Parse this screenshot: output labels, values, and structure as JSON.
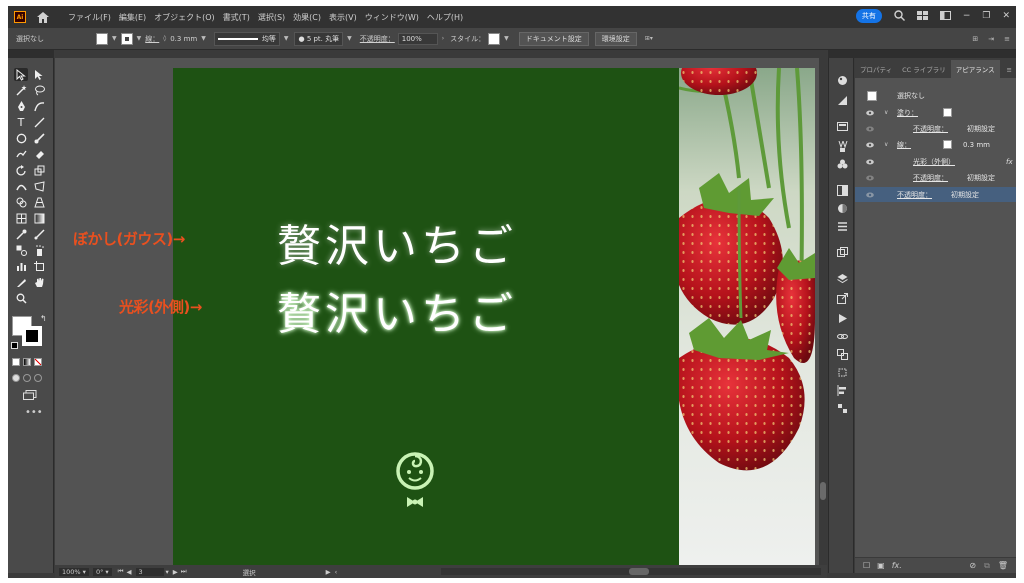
{
  "app": {
    "logo_text": "Ai"
  },
  "menu": {
    "items": [
      "ファイル(F)",
      "編集(E)",
      "オブジェクト(O)",
      "書式(T)",
      "選択(S)",
      "効果(C)",
      "表示(V)",
      "ウィンドウ(W)",
      "ヘルプ(H)"
    ],
    "share_label": "共有"
  },
  "control": {
    "selection_label": "選択なし",
    "stroke_label": "線：",
    "stroke_weight": "0.3 mm",
    "profile_label": "均等",
    "brush_label": "5 pt. 丸筆",
    "opacity_label": "不透明度：",
    "opacity_value": "100%",
    "style_label": "スタイル：",
    "doc_settings": "ドキュメント設定",
    "preferences": "環境設定"
  },
  "canvas": {
    "headline_1": "贅沢いちご",
    "headline_2": "贅沢いちご",
    "callout_1": "ぼかし(ガウス)→",
    "callout_2": "光彩(外側)→",
    "artboard_color": "#1e5213",
    "callout_color": "#e9501f"
  },
  "status": {
    "zoom": "100%",
    "rotation": "0°",
    "artboard_num": "3",
    "tool_name": "選択"
  },
  "panel": {
    "tabs": [
      "プロパティ",
      "CC ライブラリ",
      "アピアランス"
    ],
    "rows": [
      {
        "label": "選択なし"
      },
      {
        "label": "塗り："
      },
      {
        "label": "不透明度：",
        "value": "初期設定"
      },
      {
        "label": "線：",
        "value": "0.3 mm"
      },
      {
        "label": "光彩（外側）",
        "fx": "fx"
      },
      {
        "label": "不透明度：",
        "value": "初期設定"
      },
      {
        "label": "不透明度：",
        "value": "初期設定"
      }
    ],
    "bottom_fx": "fx."
  }
}
